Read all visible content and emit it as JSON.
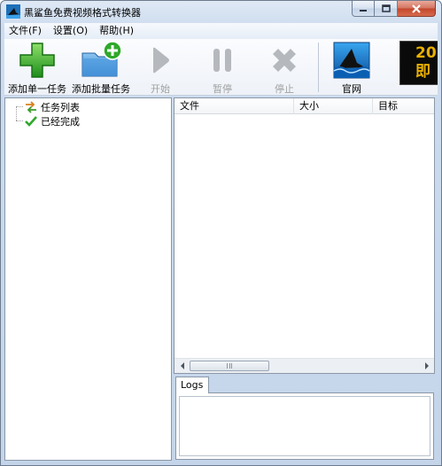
{
  "window": {
    "title": "黑鲨鱼免费视频格式转换器"
  },
  "menu": [
    {
      "label": "文件(F)"
    },
    {
      "label": "设置(O)"
    },
    {
      "label": "帮助(H)"
    }
  ],
  "toolbar": {
    "add_single": "添加单一任务",
    "add_batch": "添加批量任务",
    "start": "开始",
    "pause": "暂停",
    "stop": "停止",
    "website": "官网",
    "banner_text": "20 即"
  },
  "tree": {
    "task_list": "任务列表",
    "completed": "已经完成"
  },
  "table": {
    "columns": [
      "文件",
      "大小",
      "目标"
    ]
  },
  "logs": {
    "tab_label": "Logs"
  },
  "colors": {
    "accent_green": "#2fa82a",
    "close_red": "#c7452b",
    "folder_blue": "#3a8ad6"
  }
}
